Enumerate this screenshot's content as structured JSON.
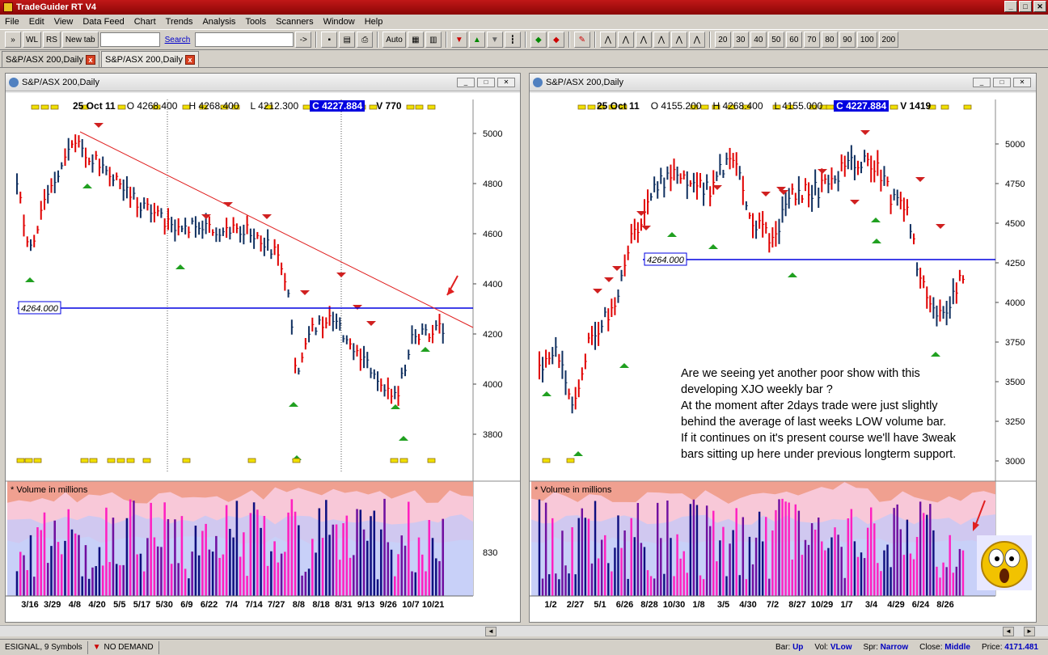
{
  "app": {
    "title": "TradeGuider RT V4"
  },
  "menu": [
    "File",
    "Edit",
    "View",
    "Data Feed",
    "Chart",
    "Trends",
    "Analysis",
    "Tools",
    "Scanners",
    "Window",
    "Help"
  ],
  "toolbar": {
    "wl": "WL",
    "rs": "RS",
    "newtab": "New tab",
    "search": "Search",
    "auto": "Auto",
    "zoom": [
      "20",
      "30",
      "40",
      "50",
      "60",
      "70",
      "80",
      "90",
      "100",
      "200"
    ]
  },
  "tabs": [
    "S&P/ASX 200,Daily",
    "S&P/ASX 200,Daily"
  ],
  "left": {
    "title": "S&P/ASX 200,Daily",
    "date": "25 Oct 11",
    "open": "O 4268.400",
    "high": "H 4268.400",
    "low": "L 4212.300",
    "close": "C 4227.884",
    "vol": "V 770",
    "level": "4264.000",
    "yticks": [
      "5000",
      "4800",
      "4600",
      "4400",
      "4200",
      "4000",
      "3800"
    ],
    "xticks": [
      "3/16",
      "3/29",
      "4/8",
      "4/20",
      "5/5",
      "5/17",
      "5/30",
      "6/9",
      "6/22",
      "7/4",
      "7/14",
      "7/27",
      "8/8",
      "8/18",
      "8/31",
      "9/13",
      "9/26",
      "10/7",
      "10/21"
    ],
    "volume_label": "* Volume in millions",
    "vol_tick": "830"
  },
  "right": {
    "title": "S&P/ASX 200,Daily",
    "date": "25 Oct 11",
    "open": "O 4155.200",
    "high": "H 4268.400",
    "low": "L 4155.000",
    "close": "C 4227.884",
    "vol": "V 1419",
    "level": "4264.000",
    "yticks": [
      "5000",
      "4750",
      "4500",
      "4250",
      "4000",
      "3750",
      "3500",
      "3250",
      "3000"
    ],
    "xticks": [
      "1/2",
      "2/27",
      "5/1",
      "6/26",
      "8/28",
      "10/30",
      "1/8",
      "3/5",
      "4/30",
      "7/2",
      "8/27",
      "10/29",
      "1/7",
      "3/4",
      "4/29",
      "6/24",
      "8/26"
    ],
    "volume_label": "* Volume in millions"
  },
  "annotation": "Are we seeing yet another poor show with this\ndeveloping XJO weekly bar ?\nAt the moment after 2days trade were just slightly\nbehind the average of last weeks LOW volume bar.\nIf it continues on it's present course we'll have 3weak\nbars sitting up here under previous longterm support.",
  "status": {
    "left": "ESIGNAL, 9 Symbols",
    "signal": "NO DEMAND",
    "bar_l": "Bar:",
    "bar": "Up",
    "vol_l": "Vol:",
    "vol": "VLow",
    "spr_l": "Spr:",
    "spr": "Narrow",
    "close_l": "Close:",
    "close": "Middle",
    "price_l": "Price:",
    "price": "4171.481"
  }
}
